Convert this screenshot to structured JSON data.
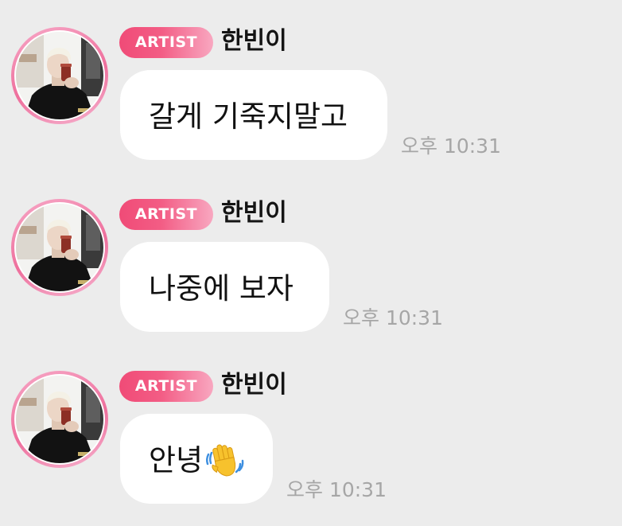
{
  "colors": {
    "background": "#ececec",
    "bubble": "#ffffff",
    "badge_start": "#f04b77",
    "badge_end": "#f8a7c0",
    "avatar_ring": "#ee6f9c",
    "timestamp": "#a6a6a6",
    "name": "#141414"
  },
  "messages": [
    {
      "badge": "ARTIST",
      "sender": "한빈이",
      "text": "갈게 기죽지말고",
      "time": "오후 10:31",
      "emoji": ""
    },
    {
      "badge": "ARTIST",
      "sender": "한빈이",
      "text": "나중에 보자",
      "time": "오후 10:31",
      "emoji": ""
    },
    {
      "badge": "ARTIST",
      "sender": "한빈이",
      "text": "안녕",
      "time": "오후 10:31",
      "emoji": "waving-hand-icon"
    }
  ]
}
